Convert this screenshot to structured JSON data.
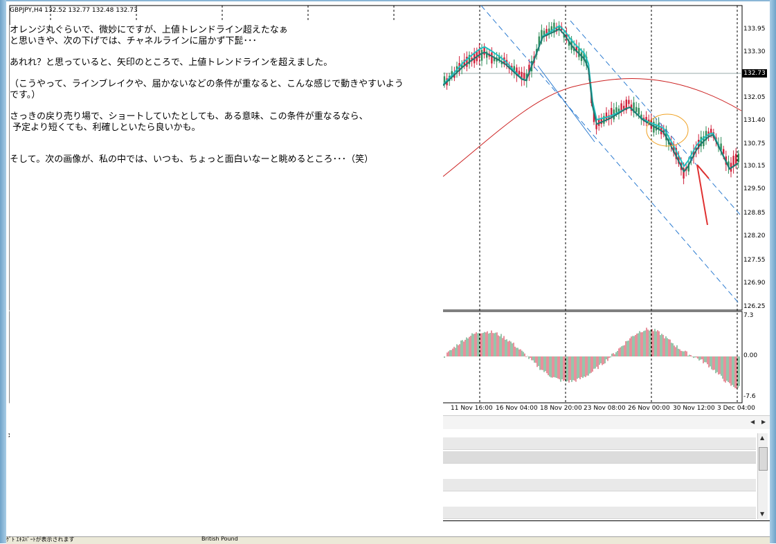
{
  "chart": {
    "header": "GBPJPY,H4  132.52 132.77 132.48 132.73",
    "current_price": "132.73",
    "price_levels": [
      "133.95",
      "133.30",
      "132.05",
      "131.40",
      "130.75",
      "130.15",
      "129.50",
      "128.85",
      "128.20",
      "127.55",
      "126.90",
      "126.25"
    ],
    "osc_levels": [
      "7.3",
      "0.00",
      "-7.6"
    ],
    "time_labels": [
      "11 Nov 16:00",
      "16 Nov 04:00",
      "18 Nov 20:00",
      "23 Nov 08:00",
      "26 Nov 00:00",
      "30 Nov 12:00",
      "3 Dec 04:00"
    ],
    "colors": {
      "bull": "#2e8b57",
      "bear": "#d0203a",
      "ma_fast": "#20c0c0",
      "ma_mid": "#1e7a72",
      "ma_slow": "#cc2020",
      "channel": "#2a7ad0",
      "circle": "#f0a020",
      "arrow": "#e03030"
    }
  },
  "note": {
    "lines": [
      "オレンジ丸ぐらいで、微妙にですが、上値トレンドライン超えたなぁ",
      "と思いきや、次の下げでは、チャネルラインに届かず下髭･･･",
      "",
      "あれれ？と思っていると、矢印のところで、上値トレンドラインを超えました。",
      "",
      "（こうやって、ラインブレイクや、届かないなどの条件が重なると、こんな感じで動きやすいよう",
      "です。）",
      "",
      "さっきの戻り売り場で、ショートしていたとしても、ある意味、この条件が重なるなら、",
      " 予定より短くても、利確しといたら良いかも。",
      "",
      "",
      "そして。次の画像が、私の中では、いつも、ちょっと面白いなーと眺めるところ･･･（笑）"
    ]
  },
  "status_bar": {
    "left_text": "ｹﾞﾄ ｴｷｽﾊﾟｰﾄが表示されます",
    "mid_text": "British Pound"
  }
}
